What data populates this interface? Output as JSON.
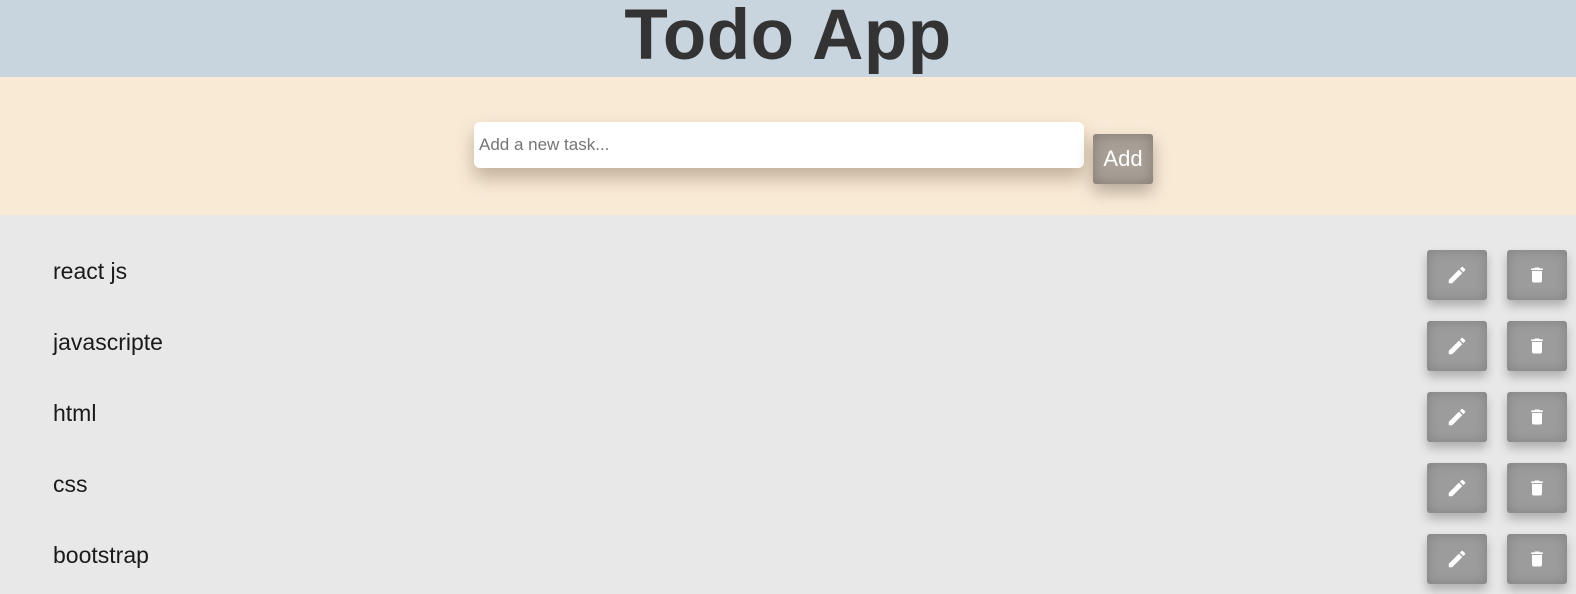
{
  "header": {
    "title": "Todo App"
  },
  "input": {
    "placeholder": "Add a new task...",
    "value": ""
  },
  "add_button": {
    "label": "Add"
  },
  "todos": [
    {
      "text": "react js"
    },
    {
      "text": "javascripte"
    },
    {
      "text": "html"
    },
    {
      "text": "css"
    },
    {
      "text": "bootstrap"
    }
  ],
  "icons": {
    "edit": "pencil-icon",
    "delete": "trash-icon"
  },
  "colors": {
    "header_bg": "#c8d5de",
    "input_bar_bg": "#f9ead6",
    "list_bg": "#e8e8e8",
    "title_text": "#333333",
    "add_button_bg": "#a8a096",
    "action_button_bg": "#9c9c9c"
  }
}
